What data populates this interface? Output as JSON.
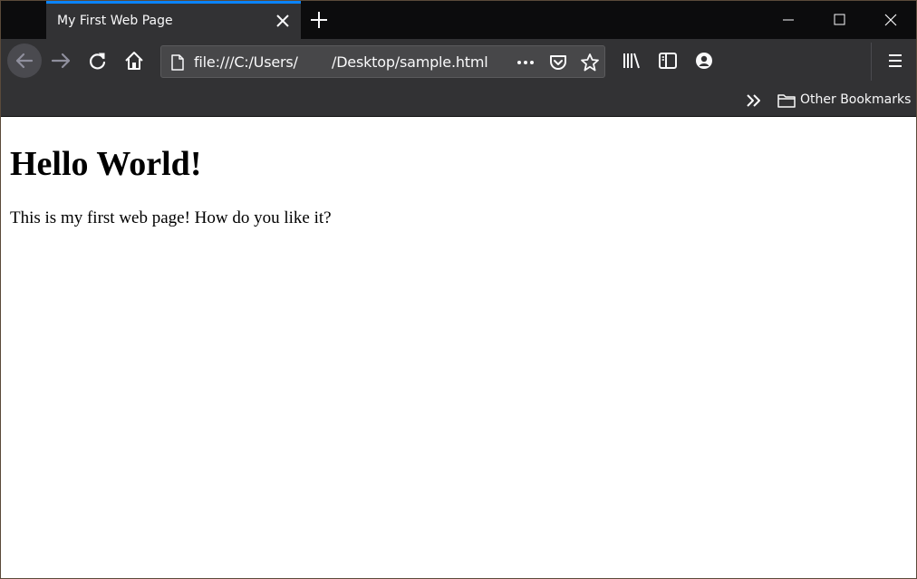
{
  "tab": {
    "title": "My First Web Page"
  },
  "urlbar": {
    "prefix": "file:///C:/Users/",
    "path": "/Desktop/sample.html"
  },
  "bookmarks": {
    "folder_label": "Other Bookmarks"
  },
  "page": {
    "heading": "Hello World!",
    "paragraph": "This is my first web page! How do you like it?"
  },
  "colors": {
    "tabbar_bg": "#0c0c0d",
    "toolbar_bg": "#323234",
    "active_tab_accent": "#0a84ff",
    "urlbar_bg": "#474749",
    "icon_color": "#f9f9fa",
    "icon_disabled": "#8f8f9d"
  },
  "icons": {
    "tab_close": "close-icon",
    "new_tab": "plus-icon",
    "minimize": "minimize-icon",
    "maximize": "maximize-icon",
    "window_close": "close-icon",
    "back": "arrow-left-icon",
    "forward": "arrow-right-icon",
    "reload": "reload-icon",
    "home": "home-icon",
    "page": "page-icon",
    "more": "more-icon",
    "pocket": "pocket-icon",
    "bookmark_star": "star-icon",
    "library": "library-icon",
    "sidebar": "sidebar-icon",
    "account": "account-icon",
    "menu": "hamburger-icon",
    "chevron": "double-chevron-icon",
    "folder": "folder-icon"
  }
}
